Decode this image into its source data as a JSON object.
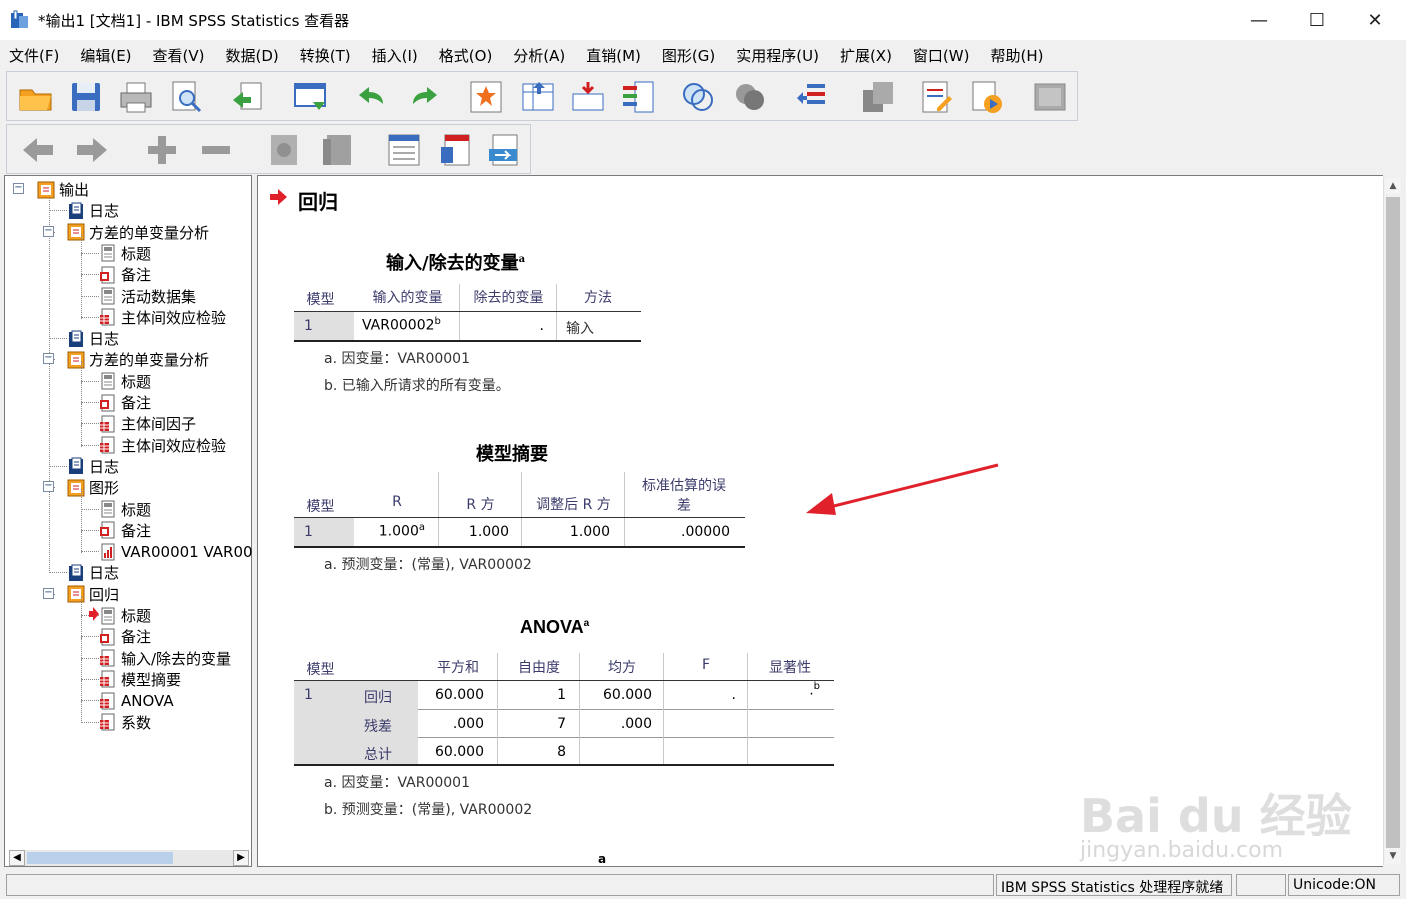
{
  "window": {
    "title": "*输出1 [文档1] - IBM SPSS Statistics 查看器",
    "minimize": "—",
    "maximize": "☐",
    "close": "✕"
  },
  "menu": [
    "文件(F)",
    "编辑(E)",
    "查看(V)",
    "数据(D)",
    "转换(T)",
    "插入(I)",
    "格式(O)",
    "分析(A)",
    "直销(M)",
    "图形(G)",
    "实用程序(U)",
    "扩展(X)",
    "窗口(W)",
    "帮助(H)"
  ],
  "toolbar1_icons": [
    "open-icon",
    "save-icon",
    "print-icon",
    "print-preview-icon",
    "export-icon",
    "recall-dialog-icon",
    "undo-icon",
    "redo-icon",
    "goto-case-icon",
    "goto-variable-icon",
    "insert-cases-icon",
    "variables-icon",
    "use-sets-icon",
    "show-all-variables-icon",
    "spell-check-icon",
    "designate-window-icon",
    "edit-icon",
    "run-icon",
    "disabled-icon"
  ],
  "toolbar2_icons": [
    "back-icon",
    "forward-icon",
    "expand-icon",
    "collapse-icon",
    "show-icon",
    "hide-icon",
    "insert-heading-icon",
    "insert-title-icon",
    "insert-text-icon"
  ],
  "outline": {
    "root": "输出",
    "items": [
      {
        "label": "日志",
        "level": 1
      },
      {
        "label": "方差的单变量分析",
        "level": 1
      },
      {
        "label": "标题",
        "level": 2
      },
      {
        "label": "备注",
        "level": 2
      },
      {
        "label": "活动数据集",
        "level": 2
      },
      {
        "label": "主体间效应检验",
        "level": 2
      },
      {
        "label": "日志",
        "level": 1
      },
      {
        "label": "方差的单变量分析",
        "level": 1
      },
      {
        "label": "标题",
        "level": 2
      },
      {
        "label": "备注",
        "level": 2
      },
      {
        "label": "主体间因子",
        "level": 2
      },
      {
        "label": "主体间效应检验",
        "level": 2
      },
      {
        "label": "日志",
        "level": 1
      },
      {
        "label": "图形",
        "level": 1
      },
      {
        "label": "标题",
        "level": 2
      },
      {
        "label": "备注",
        "level": 2
      },
      {
        "label": "VAR00001 VAR00",
        "level": 2
      },
      {
        "label": "日志",
        "level": 1
      },
      {
        "label": "回归",
        "level": 1
      },
      {
        "label": "标题",
        "level": 2
      },
      {
        "label": "备注",
        "level": 2
      },
      {
        "label": "输入/除去的变量",
        "level": 2
      },
      {
        "label": "模型摘要",
        "level": 2
      },
      {
        "label": "ANOVA",
        "level": 2
      },
      {
        "label": "系数",
        "level": 2
      }
    ]
  },
  "output": {
    "section_title": "回归",
    "table1": {
      "title": "输入/除去的变量",
      "title_sup": "a",
      "headers": [
        "模型",
        "输入的变量",
        "除去的变量",
        "方法"
      ],
      "row": {
        "model": "1",
        "entered": "VAR00002",
        "entered_sup": "b",
        "removed": ".",
        "method": "输入"
      },
      "footnotes": [
        "a. 因变量：VAR00001",
        "b. 已输入所请求的所有变量。"
      ]
    },
    "table2": {
      "title": "模型摘要",
      "headers": [
        "模型",
        "R",
        "R 方",
        "调整后 R 方",
        "标准估算的误",
        "差"
      ],
      "row": {
        "model": "1",
        "r": "1.000",
        "r_sup": "a",
        "r2": "1.000",
        "adj_r2": "1.000",
        "se": ".00000"
      },
      "footnotes": [
        "a. 预测变量：(常量), VAR00002"
      ]
    },
    "table3": {
      "title": "ANOVA",
      "title_sup": "a",
      "headers": [
        "模型",
        "平方和",
        "自由度",
        "均方",
        "F",
        "显著性"
      ],
      "model": "1",
      "rows": [
        {
          "label": "回归",
          "ss": "60.000",
          "df": "1",
          "ms": "60.000",
          "f": ".",
          "sig": ".",
          "sig_sup": "b"
        },
        {
          "label": "残差",
          "ss": ".000",
          "df": "7",
          "ms": ".000",
          "f": "",
          "sig": ""
        },
        {
          "label": "总计",
          "ss": "60.000",
          "df": "8",
          "ms": "",
          "f": "",
          "sig": ""
        }
      ],
      "footnotes": [
        "a. 因变量：VAR00001",
        "b. 预测变量：(常量), VAR00002"
      ]
    },
    "next_sup": "a"
  },
  "status": {
    "processor": "IBM SPSS Statistics 处理程序就绪",
    "unicode": "Unicode:ON"
  },
  "watermark": {
    "brand": "Bai du 经验",
    "url": "jingyan.baidu.com"
  },
  "colors": {
    "accent_red": "#e0202a",
    "folder_orange": "#f5a020",
    "log_blue": "#1b3f7a"
  }
}
